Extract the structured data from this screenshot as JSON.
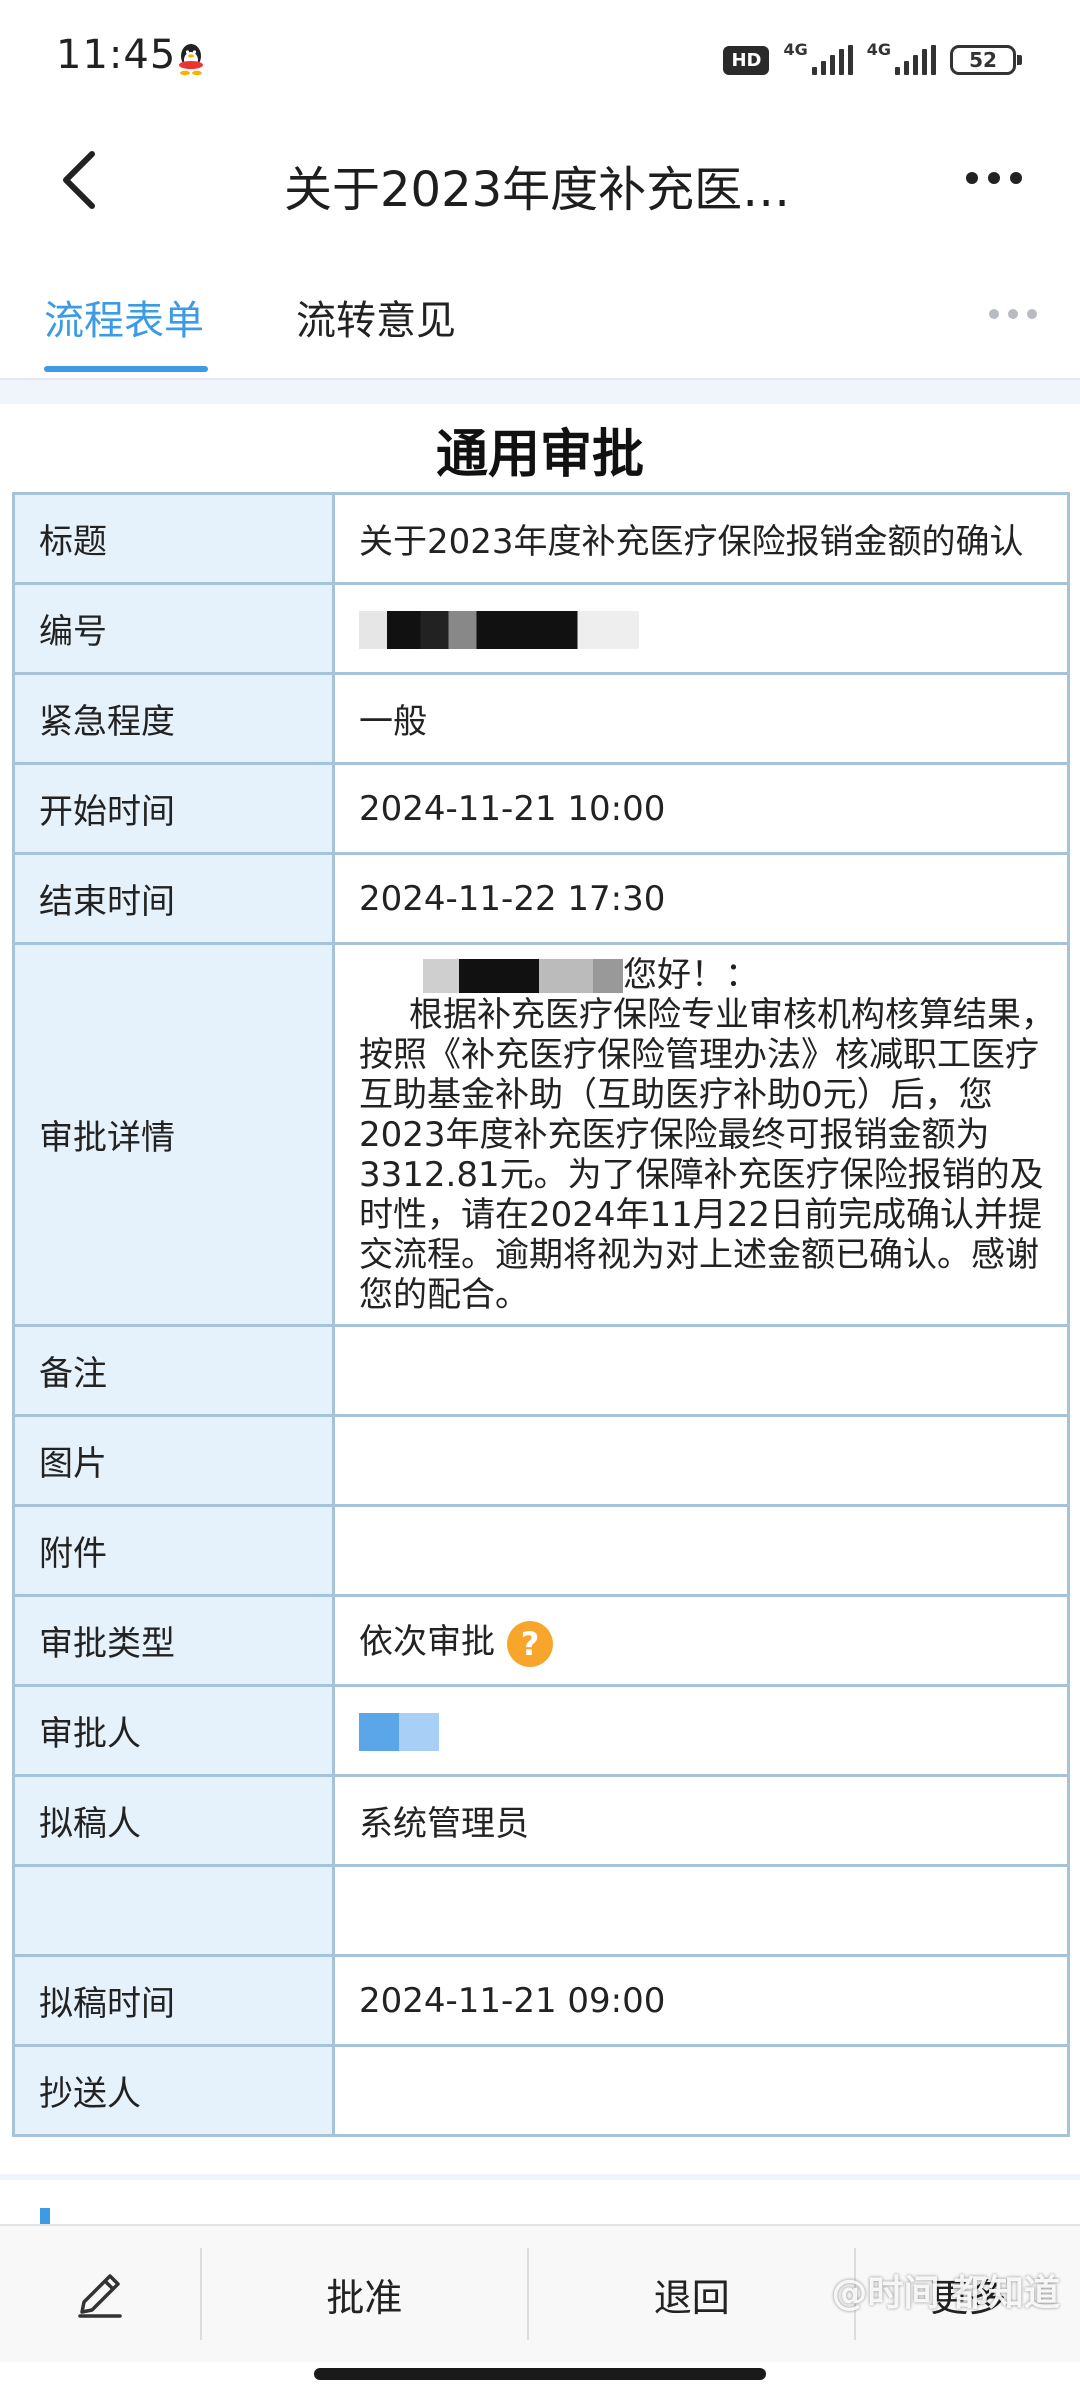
{
  "status_bar": {
    "time": "11:45",
    "hd_label": "HD",
    "network_1": "4G",
    "network_2": "4G",
    "battery": "52"
  },
  "nav": {
    "title": "关于2023年度补充医…",
    "back_icon": "chevron-left-icon",
    "more_icon": "more-horizontal-icon"
  },
  "tabs": [
    {
      "label": "流程表单",
      "active": true
    },
    {
      "label": "流转意见",
      "active": false
    }
  ],
  "form": {
    "title": "通用审批",
    "rows": {
      "subject": {
        "label": "标题",
        "value": "关于2023年度补充医疗保险报销金额的确认"
      },
      "number": {
        "label": "编号",
        "value": ""
      },
      "urgency": {
        "label": "紧急程度",
        "value": "一般"
      },
      "start_time": {
        "label": "开始时间",
        "value": "2024-11-21 10:00"
      },
      "end_time": {
        "label": "结束时间",
        "value": "2024-11-22 17:30"
      },
      "detail": {
        "label": "审批详情",
        "greeting": "您好！：",
        "body": "根据补充医疗保险专业审核机构核算结果，按照《补充医疗保险管理办法》核减职工医疗互助基金补助（互助医疗补助0元）后，您2023年度补充医疗保险最终可报销金额为3312.81元。为了保障补充医疗保险报销的及时性，请在2024年11月22日前完成确认并提交流程。逾期将视为对上述金额已确认。感谢您的配合。"
      },
      "remark": {
        "label": "备注",
        "value": ""
      },
      "picture": {
        "label": "图片",
        "value": ""
      },
      "attachment": {
        "label": "附件",
        "value": ""
      },
      "approval_type": {
        "label": "审批类型",
        "value": "依次审批",
        "help": "?"
      },
      "approver": {
        "label": "审批人",
        "value": ""
      },
      "drafter": {
        "label": "拟稿人",
        "value": "系统管理员"
      },
      "blank": {
        "label": "",
        "value": ""
      },
      "draft_time": {
        "label": "拟稿时间",
        "value": "2024-11-21 09:00"
      },
      "cc": {
        "label": "抄送人",
        "value": ""
      }
    }
  },
  "toolbar": {
    "edit_icon": "pencil-icon",
    "approve": "批准",
    "return": "退回",
    "more": "更多"
  },
  "watermark": "@时间 都知道",
  "colors": {
    "accent": "#3d9be6",
    "label_bg": "#e6f2fb",
    "border": "#a7c3d9",
    "help": "#f7a62b"
  }
}
